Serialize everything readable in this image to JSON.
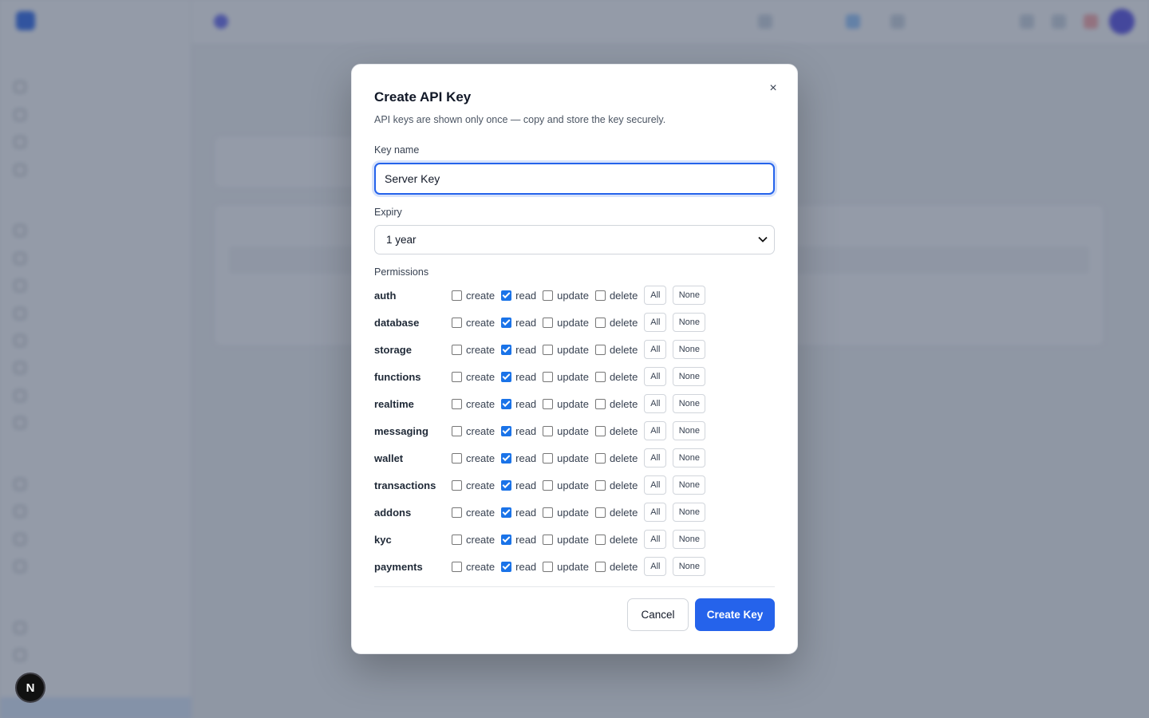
{
  "modal": {
    "title": "Create API Key",
    "description": "API keys are shown only once — copy and store the key securely.",
    "close_icon": "close-icon",
    "key_name_label": "Key name",
    "key_name_value": "Server Key",
    "expiry_label": "Expiry",
    "expiry_value": "1 year",
    "permissions_label": "Permissions",
    "actions": [
      "create",
      "read",
      "update",
      "delete"
    ],
    "all_label": "All",
    "none_label": "None",
    "permissions": [
      {
        "name": "auth",
        "checked": [
          false,
          true,
          false,
          false
        ]
      },
      {
        "name": "database",
        "checked": [
          false,
          true,
          false,
          false
        ]
      },
      {
        "name": "storage",
        "checked": [
          false,
          true,
          false,
          false
        ]
      },
      {
        "name": "functions",
        "checked": [
          false,
          true,
          false,
          false
        ]
      },
      {
        "name": "realtime",
        "checked": [
          false,
          true,
          false,
          false
        ]
      },
      {
        "name": "messaging",
        "checked": [
          false,
          true,
          false,
          false
        ]
      },
      {
        "name": "wallet",
        "checked": [
          false,
          true,
          false,
          false
        ]
      },
      {
        "name": "transactions",
        "checked": [
          false,
          true,
          false,
          false
        ]
      },
      {
        "name": "addons",
        "checked": [
          false,
          true,
          false,
          false
        ]
      },
      {
        "name": "kyc",
        "checked": [
          false,
          true,
          false,
          false
        ]
      },
      {
        "name": "payments",
        "checked": [
          false,
          true,
          false,
          false
        ]
      }
    ],
    "cancel_label": "Cancel",
    "create_label": "Create Key"
  },
  "devtools": {
    "badge_label": "N"
  },
  "colors": {
    "accent": "#2563eb",
    "overlay": "#3c4860"
  }
}
